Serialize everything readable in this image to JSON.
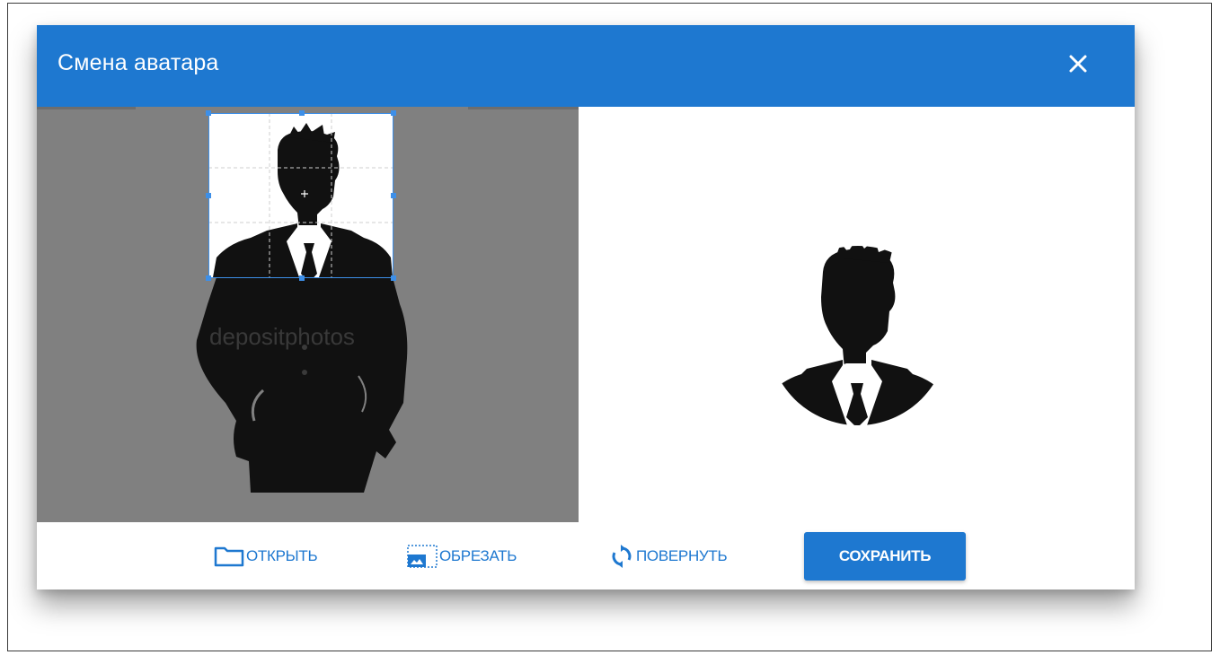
{
  "dialog": {
    "title": "Смена аватара",
    "close_icon": "close-icon"
  },
  "editor": {
    "watermark": "depositphotos"
  },
  "toolbar": {
    "open_label": "ОТКРЫТЬ",
    "crop_label": "ОБРЕЗАТЬ",
    "rotate_label": "ПОВЕРНУТЬ",
    "save_label": "СОХРАНИТЬ",
    "icons": [
      "folder-icon",
      "crop-image-icon",
      "rotate-icon"
    ]
  },
  "colors": {
    "accent": "#1e78d0",
    "editor_background": "#808080",
    "crop_border": "#3d8fe8"
  }
}
